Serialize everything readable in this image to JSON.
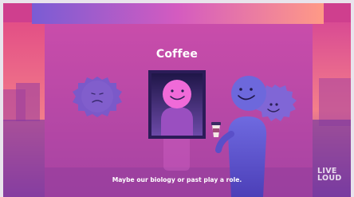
{
  "title": "Coffee",
  "caption": "Maybe our biology or past play a role.",
  "brand": {
    "line1": "LIVE",
    "line2": "LOUD"
  },
  "colors": {
    "bg_magenta": "#cf3f8e",
    "banner_top": "#7e5fd2",
    "banner_bottom": "#ff8f8a",
    "wall": "#a8419c",
    "character": "#6a61d8",
    "face_pink": "#f06ad8",
    "window_frame": "#2e1f5c"
  },
  "icons": [
    "sad-blob-icon",
    "smiling-face-icon",
    "coffee-cup-icon"
  ]
}
